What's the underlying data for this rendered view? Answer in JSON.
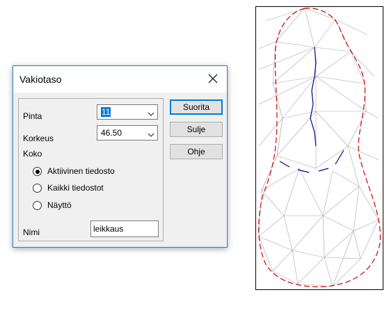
{
  "dialog": {
    "title": "Vakiotaso",
    "pinta_label": "Pinta",
    "pinta_value": "11",
    "korkeus_label": "Korkeus",
    "korkeus_value": "46.50",
    "koko_label": "Koko",
    "radio_options": [
      "Aktiivinen tiedosto",
      "Kaikki tiedostot",
      "Näyttö"
    ],
    "selected_radio": "Aktiivinen tiedosto",
    "nimi_label": "Nimi",
    "nimi_value": "leikkaus",
    "buttons": {
      "run": "Suorita",
      "close": "Sulje",
      "help": "Ohje"
    }
  },
  "colors": {
    "accent": "#0078d7",
    "boundary_line": "#cc0000",
    "contour_line": "#00008b",
    "triangulation": "#a0a0a0"
  },
  "icons": {
    "close": "close-icon",
    "dropdown": "chevron-down-icon"
  }
}
